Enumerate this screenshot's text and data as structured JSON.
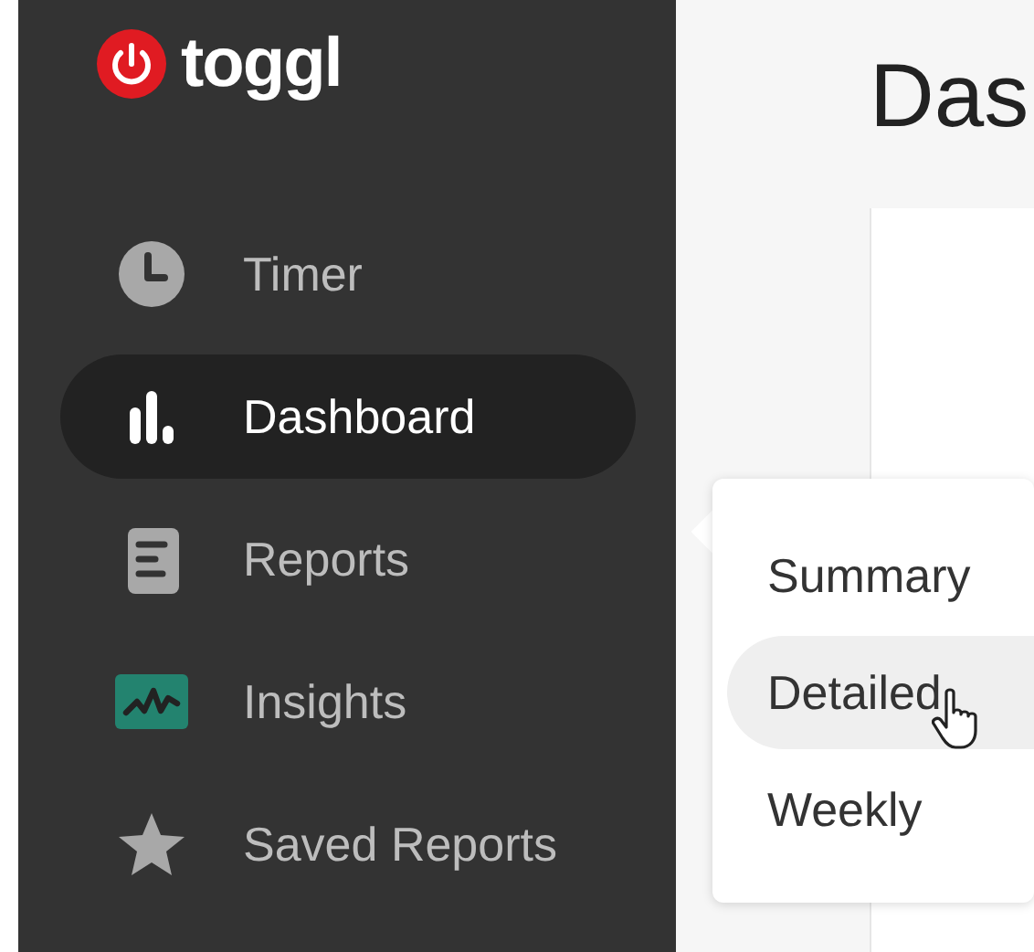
{
  "logo": {
    "text": "toggl"
  },
  "nav": [
    {
      "label": "Timer",
      "kind": "timer",
      "selected": false
    },
    {
      "label": "Dashboard",
      "kind": "dashboard",
      "selected": true
    },
    {
      "label": "Reports",
      "kind": "reports",
      "selected": false
    },
    {
      "label": "Insights",
      "kind": "insights",
      "selected": false
    },
    {
      "label": "Saved Reports",
      "kind": "saved",
      "selected": false
    }
  ],
  "page": {
    "title": "Das"
  },
  "submenu": {
    "items": [
      {
        "label": "Summary",
        "hovered": false
      },
      {
        "label": "Detailed",
        "hovered": true
      },
      {
        "label": "Weekly",
        "hovered": false
      }
    ]
  }
}
